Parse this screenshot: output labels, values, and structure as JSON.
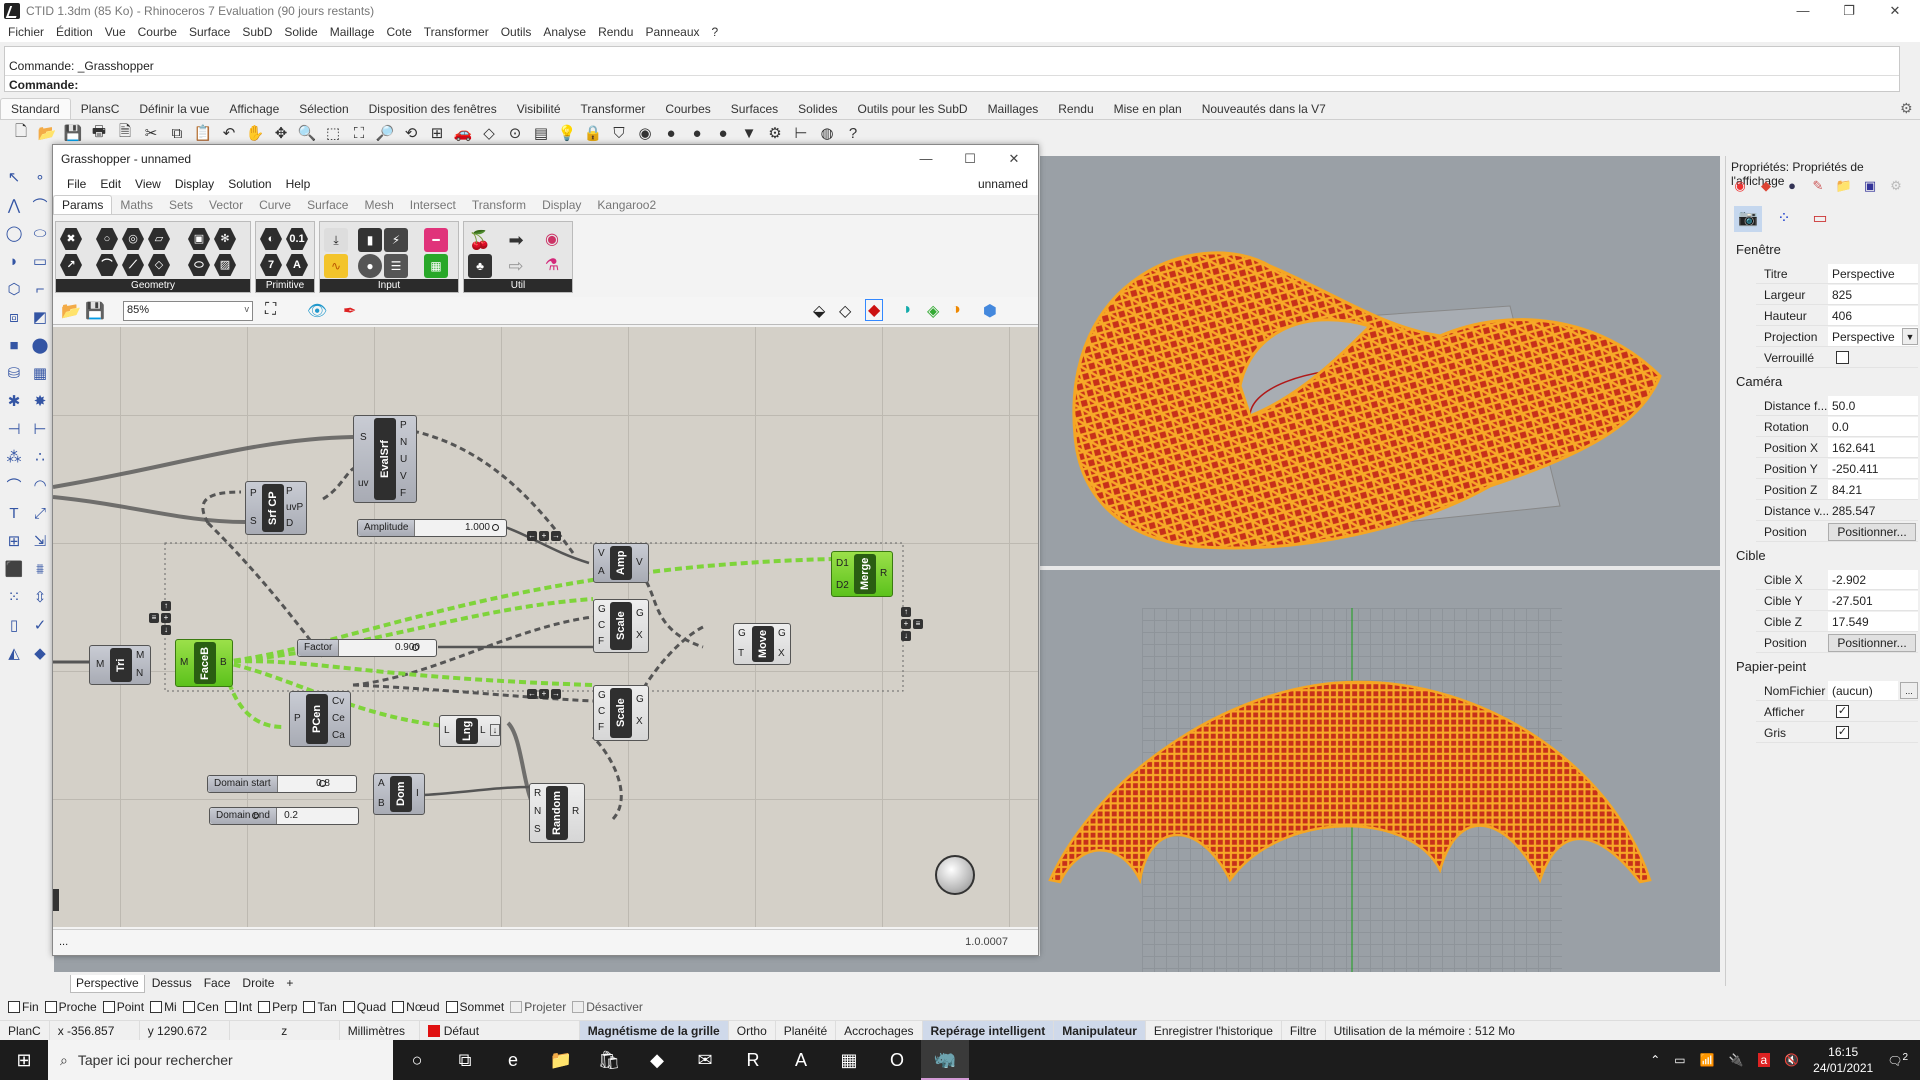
{
  "window": {
    "title": "CTID 1.3dm (85 Ko) - Rhinoceros 7 Evaluation (90 jours restants)",
    "controls": [
      "—",
      "❐",
      "✕"
    ]
  },
  "menubar": [
    "Fichier",
    "Édition",
    "Vue",
    "Courbe",
    "Surface",
    "SubD",
    "Solide",
    "Maillage",
    "Cote",
    "Transformer",
    "Outils",
    "Analyse",
    "Rendu",
    "Panneaux",
    "?"
  ],
  "command": {
    "history": "Commande: _Grasshopper",
    "prompt": "Commande:"
  },
  "toolbar_tabs": [
    "Standard",
    "PlansC",
    "Définir la vue",
    "Affichage",
    "Sélection",
    "Disposition des fenêtres",
    "Visibilité",
    "Transformer",
    "Courbes",
    "Surfaces",
    "Solides",
    "Outils pour les SubD",
    "Maillages",
    "Rendu",
    "Mise en plan",
    "Nouveautés dans la V7"
  ],
  "toolbar_tabs_active": "Standard",
  "toolbar_icons": [
    {
      "name": "new-icon",
      "glyph": "🗋"
    },
    {
      "name": "open-icon",
      "glyph": "📂"
    },
    {
      "name": "save-icon",
      "glyph": "💾"
    },
    {
      "name": "print-icon",
      "glyph": "🖶"
    },
    {
      "name": "import-icon",
      "glyph": "🗎"
    },
    {
      "name": "cut-icon",
      "glyph": "✂"
    },
    {
      "name": "copy-icon",
      "glyph": "⧉"
    },
    {
      "name": "paste-icon",
      "glyph": "📋"
    },
    {
      "name": "undo-icon",
      "glyph": "↶"
    },
    {
      "name": "pan-icon",
      "glyph": "✋"
    },
    {
      "name": "rotate-view-icon",
      "glyph": "✥"
    },
    {
      "name": "zoom-icon",
      "glyph": "🔍"
    },
    {
      "name": "zoom-window-icon",
      "glyph": "⬚"
    },
    {
      "name": "zoom-extents-icon",
      "glyph": "⛶"
    },
    {
      "name": "zoom-selected-icon",
      "glyph": "🔎"
    },
    {
      "name": "undo-view-icon",
      "glyph": "⟲"
    },
    {
      "name": "viewport-layout-icon",
      "glyph": "⊞"
    },
    {
      "name": "car-icon",
      "glyph": "🚗"
    },
    {
      "name": "cplane-icon",
      "glyph": "◇"
    },
    {
      "name": "osnap-icon",
      "glyph": "⊙"
    },
    {
      "name": "layer-icon",
      "glyph": "▤"
    },
    {
      "name": "light-icon",
      "glyph": "💡"
    },
    {
      "name": "lock-icon",
      "glyph": "🔒"
    },
    {
      "name": "properties-icon",
      "glyph": "⛉"
    },
    {
      "name": "color-wheel-icon",
      "glyph": "◉"
    },
    {
      "name": "render-sphere-icon",
      "glyph": "●"
    },
    {
      "name": "shade-sphere-icon",
      "glyph": "●"
    },
    {
      "name": "render-icon",
      "glyph": "●"
    },
    {
      "name": "filter-icon",
      "glyph": "▼"
    },
    {
      "name": "options-gear-icon",
      "glyph": "⚙"
    },
    {
      "name": "dimension-icon",
      "glyph": "⊢"
    },
    {
      "name": "grasshopper-icon",
      "glyph": "◍"
    },
    {
      "name": "help-icon",
      "glyph": "?"
    }
  ],
  "left_toolbar": [
    {
      "name": "select-arrow-icon",
      "glyph": "↖"
    },
    {
      "name": "point-icon",
      "glyph": "∘"
    },
    {
      "name": "polyline-icon",
      "glyph": "⋀"
    },
    {
      "name": "curve-icon",
      "glyph": "⌒"
    },
    {
      "name": "circle-icon",
      "glyph": "◯"
    },
    {
      "name": "ellipse-icon",
      "glyph": "⬭"
    },
    {
      "name": "arc-icon",
      "glyph": "◗"
    },
    {
      "name": "rectangle-icon",
      "glyph": "▭"
    },
    {
      "name": "polygon-icon",
      "glyph": "⬡"
    },
    {
      "name": "fillet-icon",
      "glyph": "⌐"
    },
    {
      "name": "surface-points-icon",
      "glyph": "⧈"
    },
    {
      "name": "surface-edge-icon",
      "glyph": "◩"
    },
    {
      "name": "box-icon",
      "glyph": "■"
    },
    {
      "name": "boolean-icon",
      "glyph": "⬤"
    },
    {
      "name": "extrude-icon",
      "glyph": "⛁"
    },
    {
      "name": "mesh-icon",
      "glyph": "▦"
    },
    {
      "name": "puzzle-icon",
      "glyph": "✱"
    },
    {
      "name": "explode-icon",
      "glyph": "✸"
    },
    {
      "name": "trim-icon",
      "glyph": "⊣"
    },
    {
      "name": "split-icon",
      "glyph": "⊢"
    },
    {
      "name": "group-icon",
      "glyph": "⁂"
    },
    {
      "name": "ungroup-icon",
      "glyph": "∴"
    },
    {
      "name": "offset-icon",
      "glyph": "⌒"
    },
    {
      "name": "blend-icon",
      "glyph": "◠"
    },
    {
      "name": "text-icon",
      "glyph": "T"
    },
    {
      "name": "scale-icon",
      "glyph": "⤢"
    },
    {
      "name": "array-icon",
      "glyph": "⊞"
    },
    {
      "name": "orient-icon",
      "glyph": "⇲"
    },
    {
      "name": "solid-edit-icon",
      "glyph": "⬛"
    },
    {
      "name": "plane-icon",
      "glyph": "⩩"
    },
    {
      "name": "grid-array-icon",
      "glyph": "⁙"
    },
    {
      "name": "dimension-v-icon",
      "glyph": "⇳"
    },
    {
      "name": "analyze-icon",
      "glyph": "▯"
    },
    {
      "name": "check-icon",
      "glyph": "✓"
    },
    {
      "name": "shapes-icon",
      "glyph": "◭"
    },
    {
      "name": "render-material-icon",
      "glyph": "◆"
    }
  ],
  "grasshopper": {
    "title": "Grasshopper - unnamed",
    "controls": [
      "—",
      "☐",
      "✕"
    ],
    "menu": [
      "File",
      "Edit",
      "View",
      "Display",
      "Solution",
      "Help"
    ],
    "doc_name": "unnamed",
    "tabs": [
      "Params",
      "Maths",
      "Sets",
      "Vector",
      "Curve",
      "Surface",
      "Mesh",
      "Intersect",
      "Transform",
      "Display",
      "Kangaroo2"
    ],
    "tabs_active": "Params",
    "ribbon_groups": [
      "Geometry",
      "Primitive",
      "Input",
      "Util"
    ],
    "zoom_value": "85%",
    "status_left": "...",
    "version": "1.0.0007",
    "components": {
      "evalsrf": {
        "name": "EvalSrf",
        "inputs": [
          "S",
          "uv"
        ],
        "outputs": [
          "P",
          "N",
          "U",
          "V",
          "F"
        ]
      },
      "srfcp": {
        "name": "Srf CP",
        "inputs": [
          "P",
          "S"
        ],
        "outputs": [
          "P",
          "uvP",
          "D"
        ]
      },
      "amp": {
        "name": "Amp",
        "inputs": [
          "V",
          "A"
        ],
        "outputs": [
          "V"
        ]
      },
      "scale1": {
        "name": "Scale",
        "inputs": [
          "G",
          "C",
          "F"
        ],
        "outputs": [
          "G",
          "X"
        ]
      },
      "scale2": {
        "name": "Scale",
        "inputs": [
          "G",
          "C",
          "F"
        ],
        "outputs": [
          "G",
          "X"
        ]
      },
      "move": {
        "name": "Move",
        "inputs": [
          "G",
          "T"
        ],
        "outputs": [
          "G",
          "X"
        ]
      },
      "merge": {
        "name": "Merge",
        "inputs": [
          "D1",
          "D2"
        ],
        "outputs": [
          "R"
        ]
      },
      "tri": {
        "name": "Tri",
        "inputs": [
          "M"
        ],
        "outputs": [
          "M",
          "N"
        ]
      },
      "faceb": {
        "name": "FaceB",
        "inputs": [
          "M"
        ],
        "outputs": [
          "B"
        ]
      },
      "pcen": {
        "name": "PCen",
        "inputs": [
          "P"
        ],
        "outputs": [
          "Cv",
          "Ce",
          "Ca"
        ]
      },
      "lng": {
        "name": "Lng",
        "inputs": [
          "L"
        ],
        "outputs": [
          "L"
        ]
      },
      "dom": {
        "name": "Dom",
        "inputs": [
          "A",
          "B"
        ],
        "outputs": [
          "I"
        ]
      },
      "random": {
        "name": "Random",
        "inputs": [
          "R",
          "N",
          "S"
        ],
        "outputs": [
          "R"
        ]
      }
    },
    "sliders": {
      "amplitude": {
        "label": "Amplitude",
        "value": "1.000",
        "fraction": 1.0
      },
      "factor": {
        "label": "Factor",
        "value": "0.900",
        "fraction": 0.9
      },
      "domain_start": {
        "label": "Domain start",
        "value": "0.8",
        "fraction": 0.8
      },
      "domain_end": {
        "label": "Domain end",
        "value": "0.2",
        "fraction": 0.2
      }
    }
  },
  "properties": {
    "header": "Propriétés: Propriétés de l'affichage",
    "sections": {
      "fenetre": {
        "title": "Fenêtre",
        "titre_label": "Titre",
        "titre": "Perspective",
        "largeur_label": "Largeur",
        "largeur": "825",
        "hauteur_label": "Hauteur",
        "hauteur": "406",
        "projection_label": "Projection",
        "projection": "Perspective",
        "verrouille_label": "Verrouillé",
        "verrouille": false
      },
      "camera": {
        "title": "Caméra",
        "distance_focale_label": "Distance f...",
        "distance_focale": "50.0",
        "rotation_label": "Rotation",
        "rotation": "0.0",
        "pos_x_label": "Position X",
        "pos_x": "162.641",
        "pos_y_label": "Position Y",
        "pos_y": "-250.411",
        "pos_z_label": "Position Z",
        "pos_z": "84.21",
        "distance_vue_label": "Distance v...",
        "distance_vue": "285.547",
        "position_label": "Position",
        "position_button": "Positionner..."
      },
      "cible": {
        "title": "Cible",
        "x_label": "Cible X",
        "x": "-2.902",
        "y_label": "Cible Y",
        "y": "-27.501",
        "z_label": "Cible Z",
        "z": "17.549",
        "position_label": "Position",
        "position_button": "Positionner..."
      },
      "papier_peint": {
        "title": "Papier-peint",
        "fichier_label": "NomFichier",
        "fichier": "(aucun)",
        "browse": "...",
        "afficher_label": "Afficher",
        "afficher": true,
        "gris_label": "Gris",
        "gris": true
      }
    }
  },
  "view_tabs": [
    "Perspective",
    "Dessus",
    "Face",
    "Droite",
    "+"
  ],
  "view_tabs_active": "Perspective",
  "osnaps": [
    {
      "label": "Fin",
      "checked": false,
      "enabled": true
    },
    {
      "label": "Proche",
      "checked": false,
      "enabled": true
    },
    {
      "label": "Point",
      "checked": false,
      "enabled": true
    },
    {
      "label": "Mi",
      "checked": false,
      "enabled": true
    },
    {
      "label": "Cen",
      "checked": false,
      "enabled": true
    },
    {
      "label": "Int",
      "checked": false,
      "enabled": true
    },
    {
      "label": "Perp",
      "checked": false,
      "enabled": true
    },
    {
      "label": "Tan",
      "checked": false,
      "enabled": true
    },
    {
      "label": "Quad",
      "checked": false,
      "enabled": true
    },
    {
      "label": "Nœud",
      "checked": false,
      "enabled": true
    },
    {
      "label": "Sommet",
      "checked": false,
      "enabled": true
    },
    {
      "label": "Projeter",
      "checked": false,
      "enabled": false
    },
    {
      "label": "Désactiver",
      "checked": false,
      "enabled": false
    }
  ],
  "statusbar": {
    "cplane": "PlanC",
    "x": "x -356.857",
    "y": "y 1290.672",
    "z": "z",
    "units": "Millimètres",
    "layer": "Défaut",
    "layer_color": "#e01010",
    "toggles": [
      {
        "label": "Magnétisme de la grille",
        "on": true
      },
      {
        "label": "Ortho",
        "on": false
      },
      {
        "label": "Planéité",
        "on": false
      },
      {
        "label": "Accrochages",
        "on": false
      },
      {
        "label": "Repérage intelligent",
        "on": true
      },
      {
        "label": "Manipulateur",
        "on": true
      },
      {
        "label": "Enregistrer l'historique",
        "on": false
      },
      {
        "label": "Filtre",
        "on": false
      }
    ],
    "memory": "Utilisation de la mémoire : 512 Mo"
  },
  "taskbar": {
    "search_placeholder": "Taper ici pour rechercher",
    "apps": [
      {
        "name": "cortana-icon",
        "glyph": "○"
      },
      {
        "name": "task-view-icon",
        "glyph": "⧉"
      },
      {
        "name": "edge-icon",
        "glyph": "e"
      },
      {
        "name": "file-explorer-icon",
        "glyph": "📁"
      },
      {
        "name": "store-icon",
        "glyph": "🛍"
      },
      {
        "name": "app-red-icon",
        "glyph": "◆"
      },
      {
        "name": "mail-icon",
        "glyph": "✉"
      },
      {
        "name": "revit-icon",
        "glyph": "R"
      },
      {
        "name": "autocad-icon",
        "glyph": "A"
      },
      {
        "name": "calculator-icon",
        "glyph": "▦"
      },
      {
        "name": "opera-icon",
        "glyph": "O"
      },
      {
        "name": "rhino-icon",
        "glyph": "🦏"
      }
    ],
    "time": "16:15",
    "date": "24/01/2021",
    "notifications": "2"
  },
  "colors": {
    "accent_green": "#6fd12a",
    "mesh_orange": "#f5a623",
    "mesh_red": "#b01818",
    "viewport_bg": "#9aa0a6",
    "canvas_bg": "#d4d0c8"
  }
}
